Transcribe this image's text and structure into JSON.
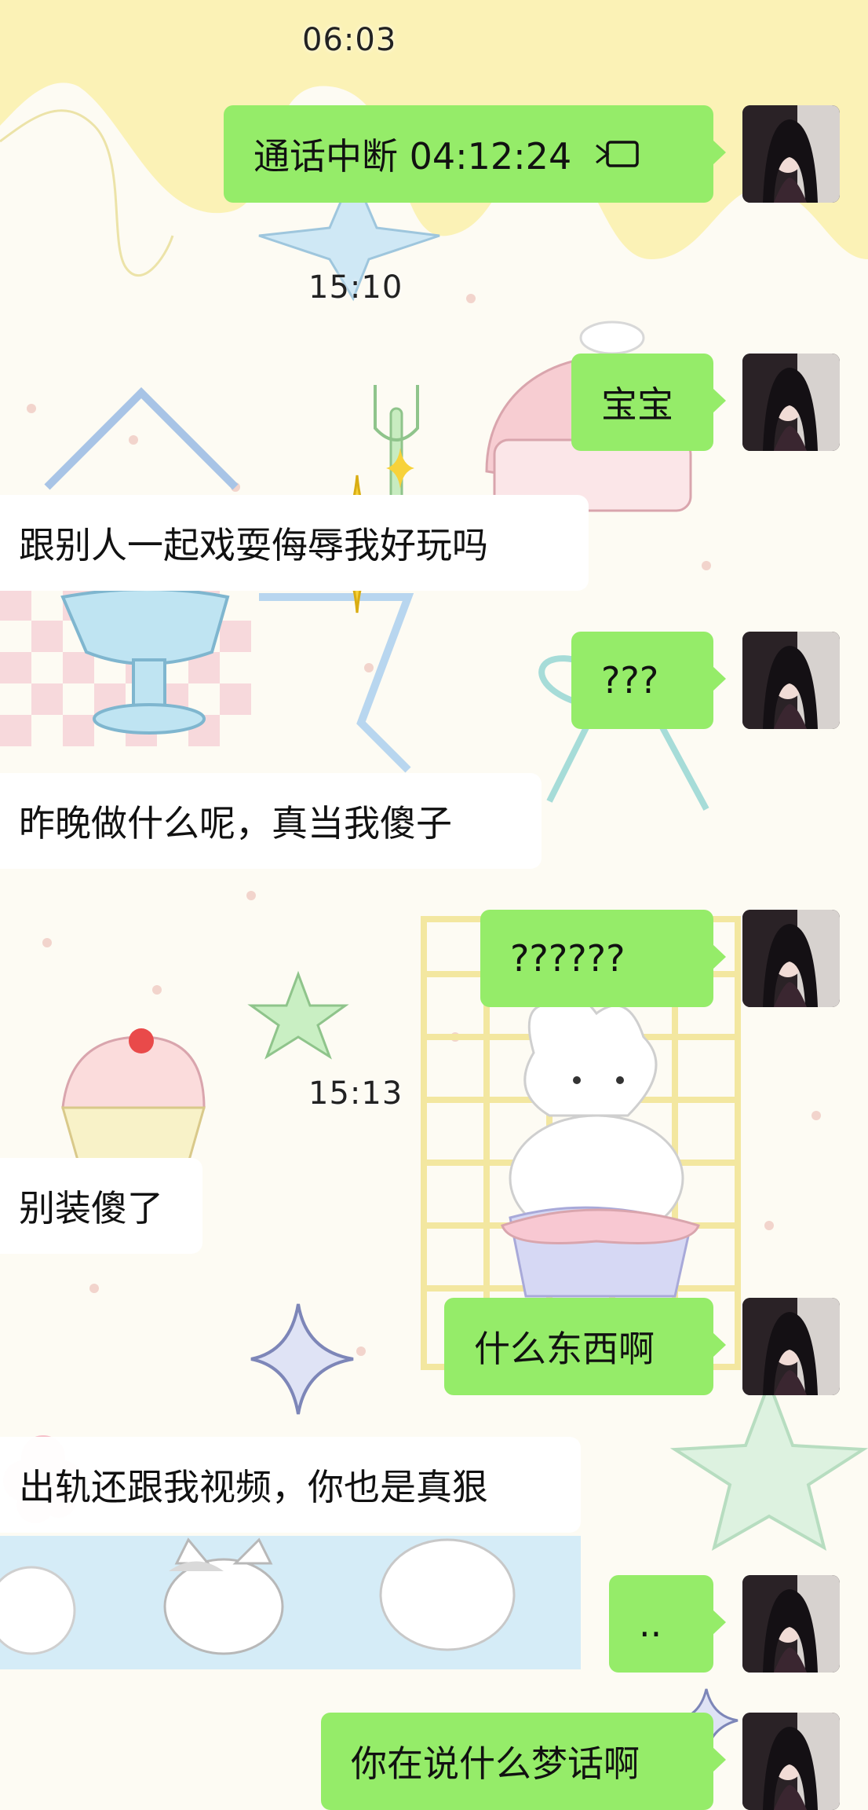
{
  "timestamps": [
    "06:03",
    "15:10",
    "15:13"
  ],
  "messages": [
    {
      "side": "outgoing",
      "text": "通话中断 04:12:24",
      "icon": "video-call-icon"
    },
    {
      "side": "outgoing",
      "text": "宝宝"
    },
    {
      "side": "incoming",
      "text": "跟别人一起戏耍侮辱我好玩吗"
    },
    {
      "side": "outgoing",
      "text": "???"
    },
    {
      "side": "incoming",
      "text": "昨晚做什么呢，真当我傻子"
    },
    {
      "side": "outgoing",
      "text": "??????"
    },
    {
      "side": "incoming",
      "text": "别装傻了"
    },
    {
      "side": "outgoing",
      "text": "什么东西啊"
    },
    {
      "side": "incoming",
      "text": "出轨还跟我视频，你也是真狠"
    },
    {
      "side": "outgoing",
      "text": ".."
    },
    {
      "side": "outgoing",
      "text": "你在说什么梦话啊"
    }
  ],
  "colors": {
    "outgoing_bubble": "#95ec69",
    "incoming_bubble": "#ffffff",
    "wallpaper": "#fdfbf3"
  }
}
